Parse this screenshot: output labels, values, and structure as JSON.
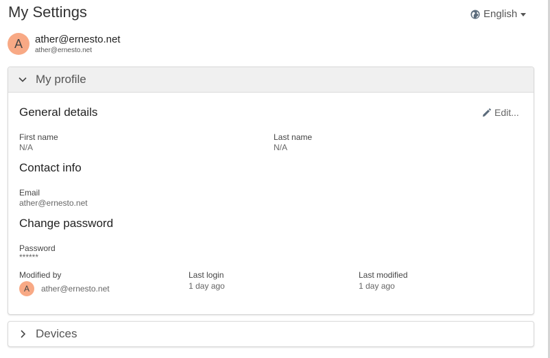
{
  "page": {
    "title": "My Settings"
  },
  "language": {
    "label": "English"
  },
  "user": {
    "initial": "A",
    "name": "ather@ernesto.net",
    "email": "ather@ernesto.net"
  },
  "profile_panel": {
    "title": "My profile",
    "general": {
      "title": "General details",
      "edit_label": "Edit...",
      "first_name_label": "First name",
      "first_name_value": "N/A",
      "last_name_label": "Last name",
      "last_name_value": "N/A"
    },
    "contact": {
      "title": "Contact info",
      "email_label": "Email",
      "email_value": "ather@ernesto.net"
    },
    "password": {
      "title": "Change password",
      "password_label": "Password",
      "password_value": "******"
    },
    "meta": {
      "modified_by_label": "Modified by",
      "modified_by_initial": "A",
      "modified_by_value": "ather@ernesto.net",
      "last_login_label": "Last login",
      "last_login_value": "1 day ago",
      "last_modified_label": "Last modified",
      "last_modified_value": "1 day ago"
    }
  },
  "devices_panel": {
    "title": "Devices"
  },
  "colors": {
    "avatar": "#f8a985",
    "header_bg": "#f0f0f0",
    "border": "#d9d9d9"
  },
  "icons": {
    "language": "globe-icon",
    "edit": "pencil-icon",
    "expanded": "chevron-down-icon",
    "collapsed": "chevron-right-icon"
  }
}
